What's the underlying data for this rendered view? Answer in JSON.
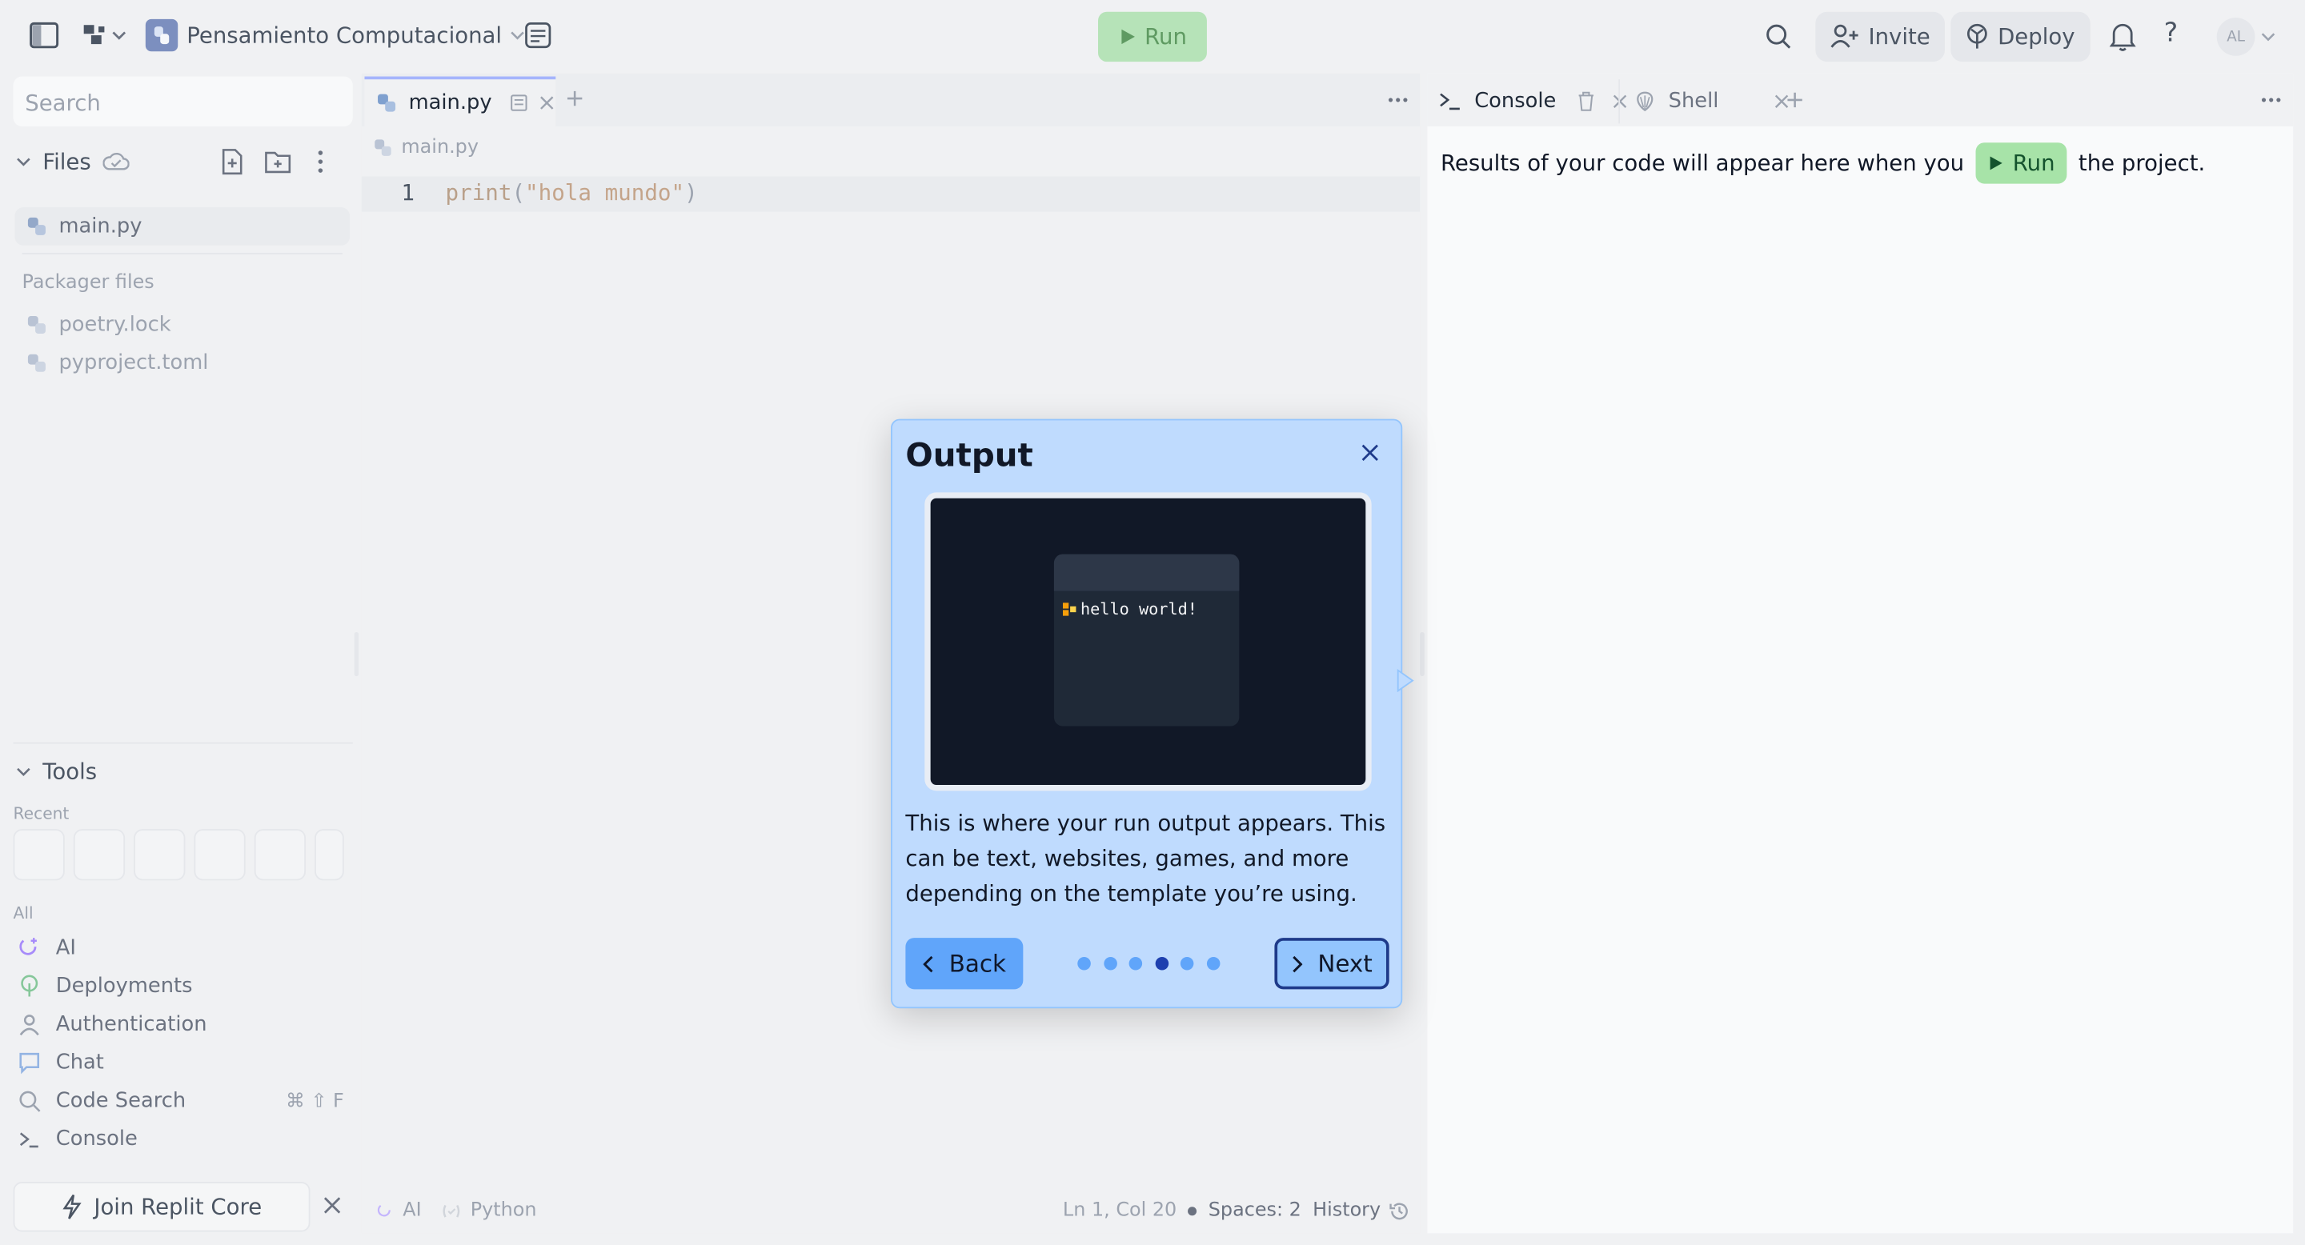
{
  "topbar": {
    "project_name": "Pensamiento Computacional",
    "run_label": "Run",
    "invite_label": "Invite",
    "deploy_label": "Deploy",
    "avatar_initials": "AL"
  },
  "sidebar": {
    "search_placeholder": "Search",
    "files_label": "Files",
    "files": [
      {
        "name": "main.py"
      }
    ],
    "packager_label": "Packager files",
    "packager_files": [
      {
        "name": "poetry.lock"
      },
      {
        "name": "pyproject.toml"
      }
    ],
    "tools_label": "Tools",
    "recent_label": "Recent",
    "all_label": "All",
    "tools": [
      {
        "label": "AI",
        "icon": "ai-icon"
      },
      {
        "label": "Deployments",
        "icon": "deploy-icon"
      },
      {
        "label": "Authentication",
        "icon": "user-icon"
      },
      {
        "label": "Chat",
        "icon": "chat-icon"
      },
      {
        "label": "Code Search",
        "icon": "search-icon",
        "shortcut": "⌘ ⇧ F"
      },
      {
        "label": "Console",
        "icon": "terminal-icon"
      }
    ],
    "join_label": "Join Replit Core"
  },
  "editor": {
    "tab_label": "main.py",
    "breadcrumb": "main.py",
    "line_number": "1",
    "code_fn": "print",
    "code_open": "(",
    "code_string": "\"hola mundo\"",
    "code_close": ")",
    "status": {
      "ai": "AI",
      "language": "Python",
      "position": "Ln 1, Col 20",
      "spaces": "Spaces: 2",
      "history": "History"
    }
  },
  "console": {
    "tab_console": "Console",
    "tab_shell": "Shell",
    "message_before": "Results of your code will appear here when you",
    "run_label": "Run",
    "message_after": "the project."
  },
  "modal": {
    "title": "Output",
    "terminal_text": "hello world!",
    "body": "This is where your run output appears. This can be text, websites, games, and more depending on the template you’re using.",
    "back_label": "Back",
    "next_label": "Next",
    "steps_total": 6,
    "step_current": 4
  },
  "colors": {
    "accent_green": "#a7e3a8",
    "modal_bg": "#bfdbfe",
    "modal_button": "#60a5fa",
    "dot_active": "#1e40af"
  }
}
